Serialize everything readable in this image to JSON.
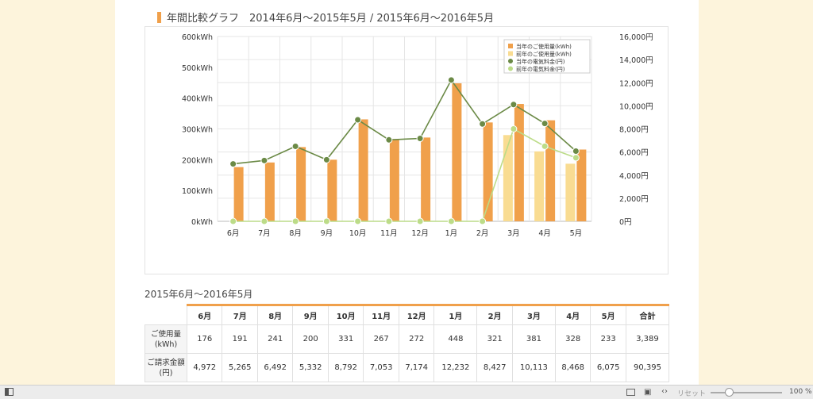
{
  "title": "年間比較グラフ　2014年6月～2015年5月 / 2015年6月～2016年5月",
  "subtitle": "2015年6月～2016年5月",
  "chart_data": {
    "type": "bar",
    "categories": [
      "6月",
      "7月",
      "8月",
      "9月",
      "10月",
      "11月",
      "12月",
      "1月",
      "2月",
      "3月",
      "4月",
      "5月"
    ],
    "series": [
      {
        "name": "前年のご使用量(kWh)",
        "kind": "bar",
        "axis": "left",
        "color": "#f9dc92",
        "values": [
          0,
          0,
          0,
          0,
          0,
          0,
          0,
          0,
          0,
          280,
          227,
          187
        ]
      },
      {
        "name": "当年のご使用量(kWh)",
        "kind": "bar",
        "axis": "left",
        "color": "#f0a04b",
        "values": [
          176,
          191,
          241,
          200,
          331,
          267,
          272,
          448,
          321,
          381,
          328,
          233
        ]
      },
      {
        "name": "当年の電気料金(円)",
        "kind": "line",
        "axis": "right",
        "color": "#6b8a46",
        "values": [
          4972,
          5265,
          6492,
          5332,
          8792,
          7053,
          7174,
          12232,
          8427,
          10113,
          8468,
          6075
        ]
      },
      {
        "name": "前年の電気料金(円)",
        "kind": "line",
        "axis": "right",
        "color": "#bcdc88",
        "values": [
          0,
          0,
          0,
          0,
          0,
          0,
          0,
          0,
          0,
          8000,
          6500,
          5500
        ]
      }
    ],
    "legend_order": [
      "当年のご使用量(kWh)",
      "前年のご使用量(kWh)",
      "当年の電気料金(円)",
      "前年の電気料金(円)"
    ],
    "y_left": {
      "ylim": [
        0,
        600
      ],
      "ticks": [
        "0kWh",
        "100kWh",
        "200kWh",
        "300kWh",
        "400kWh",
        "500kWh",
        "600kWh"
      ]
    },
    "y_right": {
      "ylim": [
        0,
        16000
      ],
      "ticks": [
        "0円",
        "2,000円",
        "4,000円",
        "6,000円",
        "8,000円",
        "10,000円",
        "12,000円",
        "14,000円",
        "16,000円"
      ]
    },
    "grid": true,
    "legend_position": "top-right"
  },
  "table": {
    "columns": [
      "6月",
      "7月",
      "8月",
      "9月",
      "10月",
      "11月",
      "12月",
      "1月",
      "2月",
      "3月",
      "4月",
      "5月",
      "合計"
    ],
    "rows": [
      {
        "label1": "ご使用量",
        "label2": "(kWh)",
        "values": [
          "176",
          "191",
          "241",
          "200",
          "331",
          "267",
          "272",
          "448",
          "321",
          "381",
          "328",
          "233",
          "3,389"
        ]
      },
      {
        "label1": "ご請求金額",
        "label2": "(円)",
        "values": [
          "4,972",
          "5,265",
          "6,492",
          "5,332",
          "8,792",
          "7,053",
          "7,174",
          "12,232",
          "8,427",
          "10,113",
          "8,468",
          "6,075",
          "90,395"
        ]
      }
    ]
  },
  "statusbar": {
    "reset": "リセット",
    "zoom": "100 %"
  }
}
